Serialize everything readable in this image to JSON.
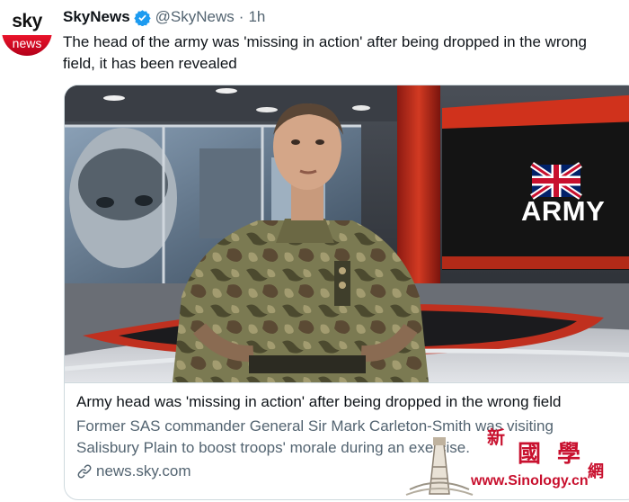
{
  "account": {
    "avatar_top": "sky",
    "avatar_bottom": "news",
    "display_name": "SkyNews",
    "handle": "@SkyNews",
    "separator": "·",
    "timestamp": "1h",
    "verified_icon": "verified-badge-icon"
  },
  "tweet": {
    "text": "The head of the army was 'missing in action' after being dropped in the wrong field, it has been revealed"
  },
  "card": {
    "image_overlay_text": "ARMY",
    "title": "Army head was 'missing in action' after being dropped in the wrong field",
    "description": "Former SAS commander General Sir Mark Carleton-Smith was visiting Salisbury Plain to boost troops' morale during an exercise.",
    "domain": "news.sky.com",
    "domain_icon": "link-icon"
  },
  "watermark": {
    "chars": [
      "新",
      "國",
      "學",
      "網"
    ],
    "url": "www.Sinology.cn"
  },
  "colors": {
    "brand_red": "#e9132a",
    "verified_blue": "#1d9bf0",
    "secondary_text": "#536471",
    "border": "#cfd9de"
  }
}
